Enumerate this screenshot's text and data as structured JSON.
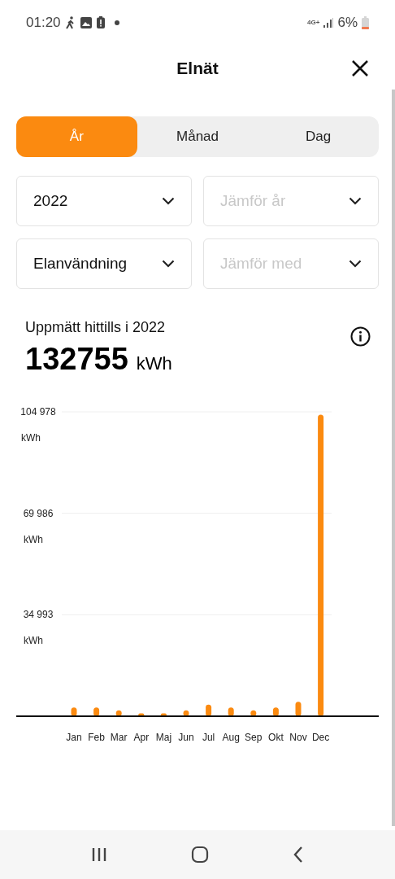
{
  "status_bar": {
    "time": "01:20",
    "network": "4G+",
    "battery": "6%"
  },
  "header": {
    "title": "Elnät"
  },
  "tabs": [
    {
      "label": "År",
      "selected": true
    },
    {
      "label": "Månad",
      "selected": false
    },
    {
      "label": "Dag",
      "selected": false
    }
  ],
  "dropdowns": [
    {
      "value": "2022"
    },
    {
      "placeholder": "Jämför år"
    },
    {
      "value": "Elanvändning"
    },
    {
      "placeholder": "Jämför med"
    }
  ],
  "summary": {
    "label": "Uppmätt hittills i 2022",
    "value": "132755",
    "unit": "kWh"
  },
  "chart": {
    "ytick_units": [
      "kWh",
      "kWh",
      "kWh"
    ],
    "chart_data": {
      "type": "bar",
      "categories": [
        "Jan",
        "Feb",
        "Mar",
        "Apr",
        "Maj",
        "Jun",
        "Jul",
        "Aug",
        "Sep",
        "Okt",
        "Nov",
        "Dec"
      ],
      "series": [
        {
          "color": "#fb8a10",
          "values": [
            3000,
            3000,
            2000,
            1000,
            1000,
            2000,
            4000,
            3000,
            2000,
            3000,
            5000,
            104000
          ]
        }
      ],
      "ylim": [
        0,
        104978
      ],
      "yticks": [
        {
          "value": 104978,
          "label": "104 978"
        },
        {
          "value": 69986,
          "label": "69 986"
        },
        {
          "value": 34993,
          "label": "34 993"
        }
      ]
    }
  }
}
